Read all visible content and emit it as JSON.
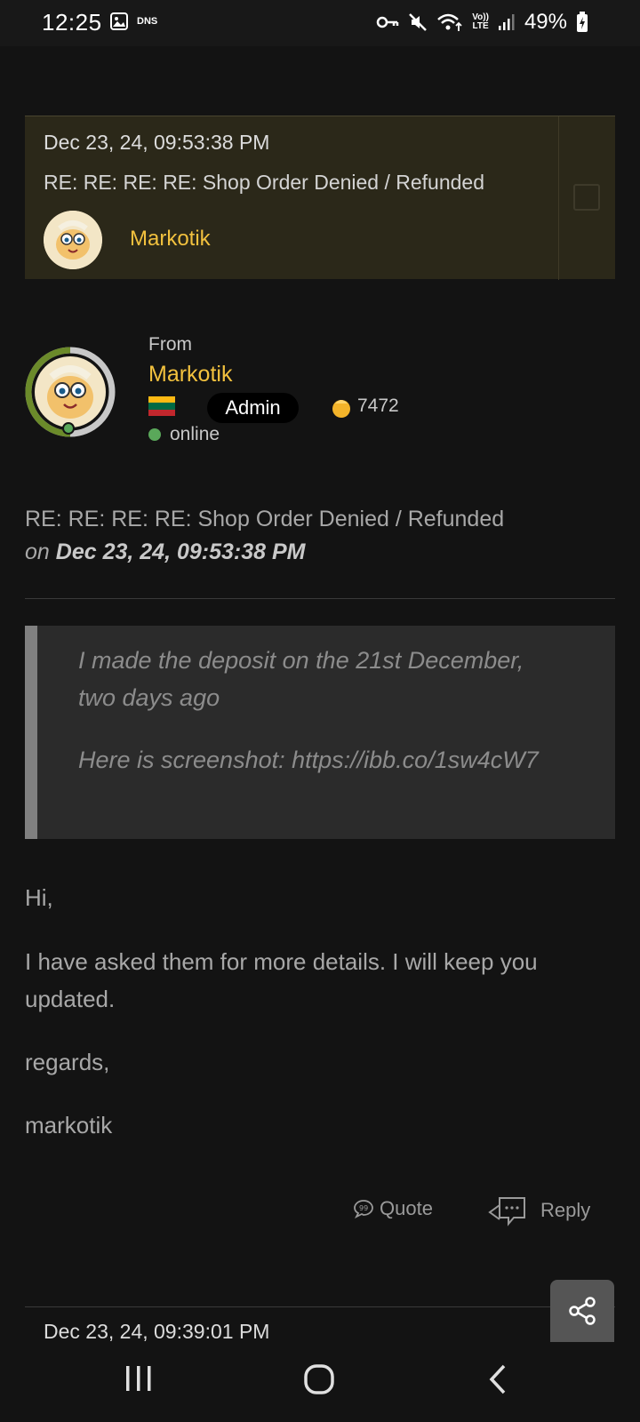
{
  "status_bar": {
    "time": "12:25",
    "dns_label": "DNS",
    "lte_label_top": "Vo))",
    "lte_label_bottom": "LTE",
    "battery": "49%"
  },
  "message_card": {
    "date": "Dec 23, 24, 09:53:38 PM",
    "subject": "RE: RE: RE: RE: Shop Order Denied / Refunded",
    "author": "Markotik"
  },
  "sender": {
    "from_label": "From",
    "name": "Markotik",
    "role": "Admin",
    "points": "7472",
    "status": "online",
    "flag_colors": [
      "#fdb913",
      "#006a44",
      "#c1272d"
    ]
  },
  "post": {
    "subject": "RE: RE: RE: RE: Shop Order Denied / Refunded",
    "on_label": "on",
    "date": "Dec 23, 24, 09:53:38 PM",
    "quote_lines": [
      "I made the deposit on the 21st December,",
      "two days ago",
      "Here is screenshot: https://ibb.co/1sw4cW7"
    ],
    "body": [
      "Hi,",
      "I have asked them for more details. I will keep you",
      "updated.",
      "regards,",
      "markotik"
    ]
  },
  "actions": {
    "quote_label": "Quote",
    "reply_label": "Reply"
  },
  "next_message": {
    "date": "Dec 23, 24, 09:39:01 PM"
  },
  "colors": {
    "accent": "#f2c13e",
    "background": "#131313",
    "card": "#2b2819"
  }
}
